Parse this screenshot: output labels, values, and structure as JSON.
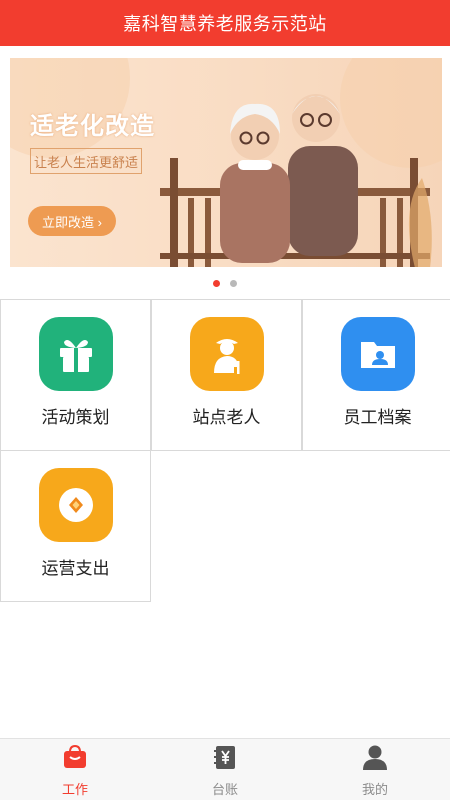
{
  "header": {
    "title": "嘉科智慧养老服务示范站"
  },
  "banner": {
    "title": "适老化改造",
    "subtitle": "让老人生活更舒适",
    "cta": "立即改造 ›"
  },
  "carousel": {
    "count": 2,
    "active_index": 0
  },
  "grid": {
    "items": [
      {
        "label": "活动策划",
        "icon": "gift-icon",
        "color": "#21b27b"
      },
      {
        "label": "站点老人",
        "icon": "elderly-person-icon",
        "color": "#f7a81b"
      },
      {
        "label": "员工档案",
        "icon": "folder-profile-icon",
        "color": "#2f8ff0"
      },
      {
        "label": "运营支出",
        "icon": "coin-icon",
        "color": "#f7a81b"
      }
    ]
  },
  "tabbar": {
    "items": [
      {
        "label": "工作",
        "icon": "briefcase-icon",
        "active": true
      },
      {
        "label": "台账",
        "icon": "ledger-yen-icon",
        "active": false
      },
      {
        "label": "我的",
        "icon": "user-icon",
        "active": false
      }
    ]
  },
  "colors": {
    "primary": "#f23d2f",
    "inactive": "#8c8c8c"
  }
}
